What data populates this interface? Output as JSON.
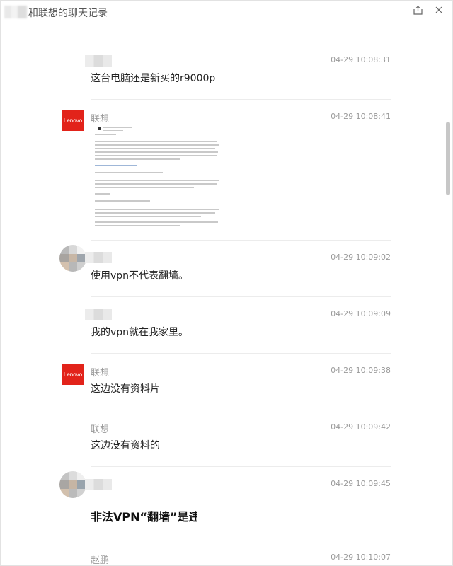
{
  "window": {
    "title": "和联想的聊天记录",
    "share_icon": "share-icon",
    "close_icon": "close-icon"
  },
  "messages": [
    {
      "sender": "",
      "time": "04-29 10:08:31",
      "text": "这台电脑还是新买的r9000p",
      "avatar": "none"
    },
    {
      "sender": "联想",
      "time": "04-29 10:08:41",
      "text": "",
      "avatar": "lenovo",
      "avatar_label": "Lenovo",
      "attachment": "screenshot-image"
    },
    {
      "sender": "",
      "time": "04-29 10:09:02",
      "text": "使用vpn不代表翻墙。",
      "avatar": "mosaic"
    },
    {
      "sender": "",
      "time": "04-29 10:09:09",
      "text": "我的vpn就在我家里。",
      "avatar": "none"
    },
    {
      "sender": "联想",
      "time": "04-29 10:09:38",
      "text": "这边没有资料片",
      "avatar": "lenovo",
      "avatar_label": "Lenovo"
    },
    {
      "sender": "联想",
      "time": "04-29 10:09:42",
      "text": "这边没有资料的",
      "avatar": "none"
    },
    {
      "sender": "",
      "time": "04-29 10:09:45",
      "text": "非法VPN“翻墙”是违",
      "avatar": "mosaic"
    },
    {
      "sender": "赵鹏",
      "time": "04-29 10:10:07",
      "text": "",
      "avatar": "none"
    }
  ],
  "colors": {
    "lenovo_red": "#e2231a",
    "time_gray": "#9a9a9a",
    "divider": "#ececec"
  }
}
